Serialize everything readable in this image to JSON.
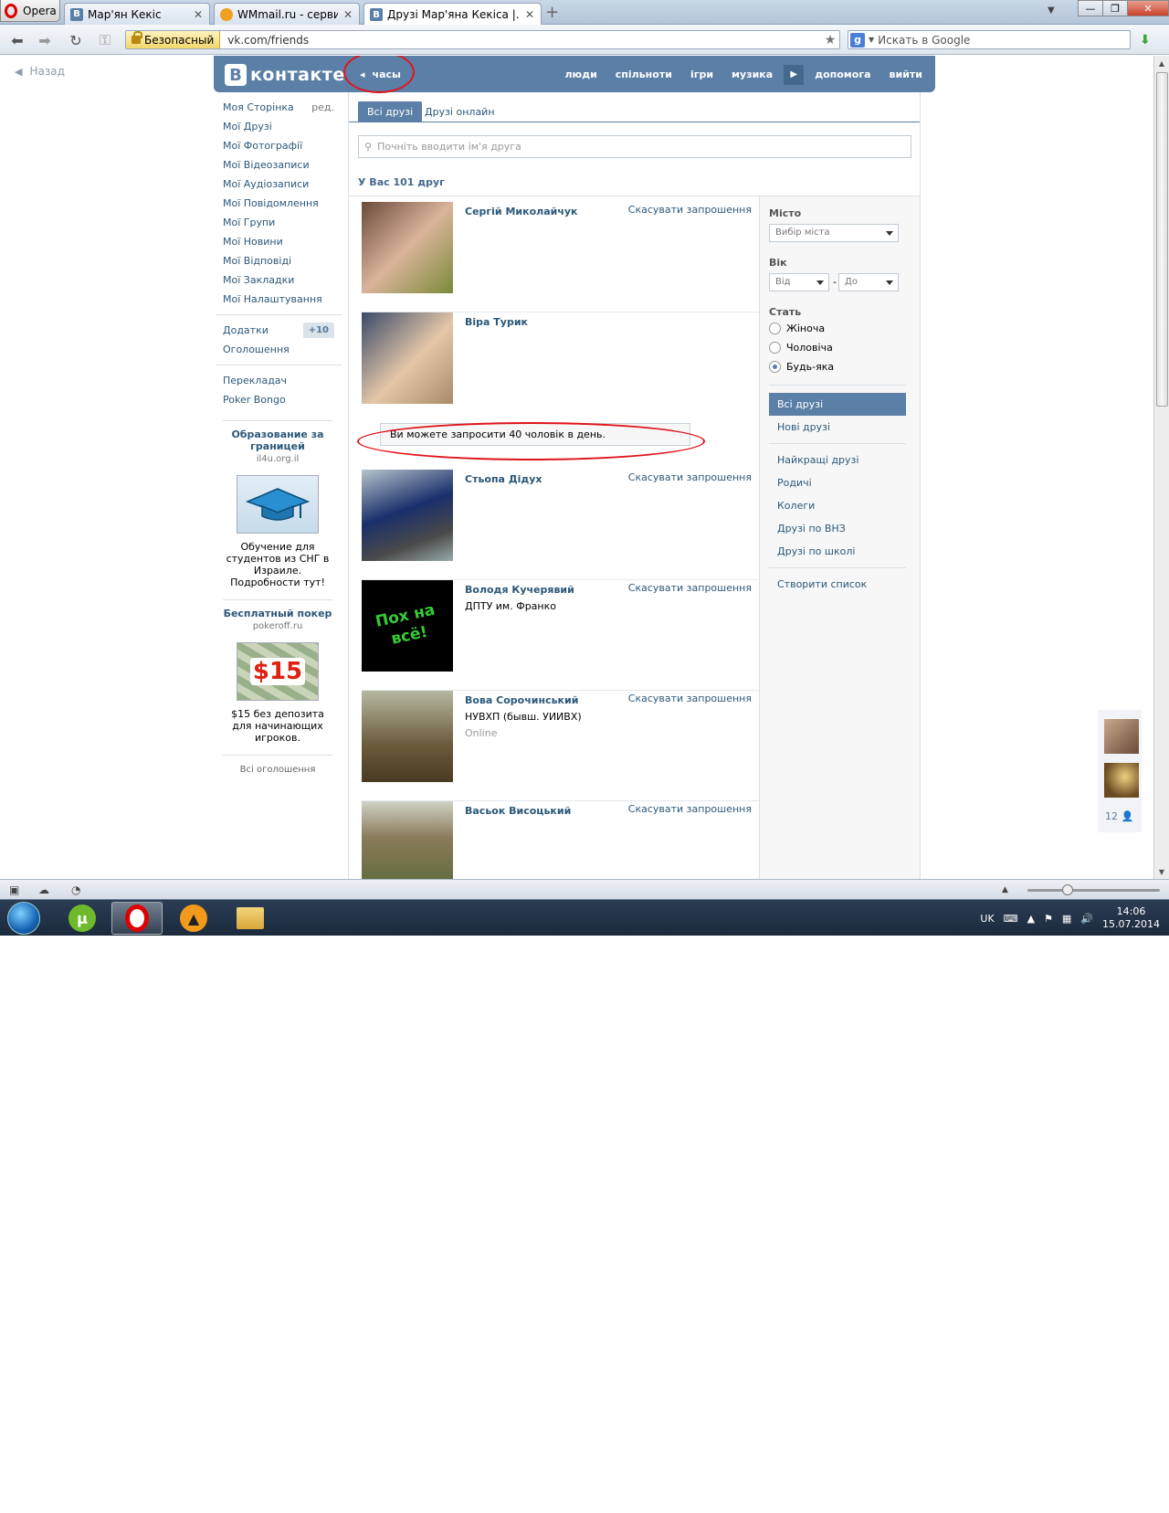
{
  "browser": {
    "opera_label": "Opera",
    "tabs": [
      {
        "label": "Мар'ян Кекіс",
        "fav": "B"
      },
      {
        "label": "WMmail.ru - сервис п...",
        "fav": ""
      },
      {
        "label": "Друзі Мар'яна Кекіса |...",
        "fav": "B"
      }
    ],
    "secure_label": "Безопасный",
    "url": "vk.com/friends",
    "search_placeholder": "Искать в Google",
    "search_engine": "g"
  },
  "page": {
    "back_label": "Назад",
    "logo_b": "B",
    "logo_word": "контакте",
    "player_label": "часы",
    "top_menu": [
      "люди",
      "спільноти",
      "ігри",
      "музика",
      "допомога",
      "вийти"
    ]
  },
  "left_menu": {
    "items": [
      "Моя Сторінка",
      "Мої Друзі",
      "Мої Фотографії",
      "Мої Відеозаписи",
      "Мої Аудіозаписи",
      "Мої Повідомлення",
      "Мої Групи",
      "Мої Новини",
      "Мої Відповіді",
      "Мої Закладки",
      "Мої Налаштування"
    ],
    "edit_label": "ред.",
    "apps_label": "Додатки",
    "apps_badge": "+10",
    "ads_label": "Оголошення",
    "extra": [
      "Перекладач",
      "Poker Bongo"
    ]
  },
  "ads": [
    {
      "title": "Образование за границей",
      "domain": "il4u.org.il",
      "text": "Обучение для студентов из СНГ в Израиле. Подробности тут!"
    },
    {
      "title": "Бесплатный покер",
      "domain": "pokeroff.ru",
      "text": "$15 без депозита для начинающих игроков.",
      "img_text": "$15"
    }
  ],
  "ads_all": "Всі оголошення",
  "tabs": {
    "all": "Всі друзі",
    "online": "Друзі онлайн"
  },
  "search_friend_placeholder": "Почніть вводити ім'я друга",
  "friends_count": "У Вас 101 друг",
  "friends": [
    {
      "name": "Сергій Миколайчук",
      "sub": "",
      "online": "",
      "action": "Скасувати запрошення"
    },
    {
      "name": "Віра Турик",
      "sub": "",
      "online": "",
      "action": ""
    },
    {
      "name": "Стьопа Дідух",
      "sub": "",
      "online": "",
      "action": "Скасувати запрошення"
    },
    {
      "name": "Володя Кучерявий",
      "sub": "ДПТУ им. Франко",
      "online": "",
      "action": "Скасувати запрошення"
    },
    {
      "name": "Вова Сорочинський",
      "sub": "НУВХП (бывш. УИИВХ)",
      "online": "Online",
      "action": "Скасувати запрошення"
    },
    {
      "name": "Васьок Висоцький",
      "sub": "",
      "online": "",
      "action": "Скасувати запрошення"
    }
  ],
  "avatar_text": "Пох на всё!",
  "notice": "Ви можете запросити 40 чоловік в день.",
  "filters": {
    "city_label": "Місто",
    "city_select": "Вибір міста",
    "age_label": "Вік",
    "age_from": "Від",
    "age_to": "До",
    "age_dash": "-",
    "sex_label": "Стать",
    "sex_options": [
      "Жіноча",
      "Чоловіча",
      "Будь-яка"
    ],
    "lists": [
      "Всі друзі",
      "Нові друзі",
      "Найкращі друзі",
      "Родичі",
      "Колеги",
      "Друзі по ВНЗ",
      "Друзі по школі",
      "Створити список"
    ]
  },
  "dock_count": "12",
  "taskbar": {
    "lang": "UK",
    "time": "14:06",
    "date": "15.07.2014"
  }
}
